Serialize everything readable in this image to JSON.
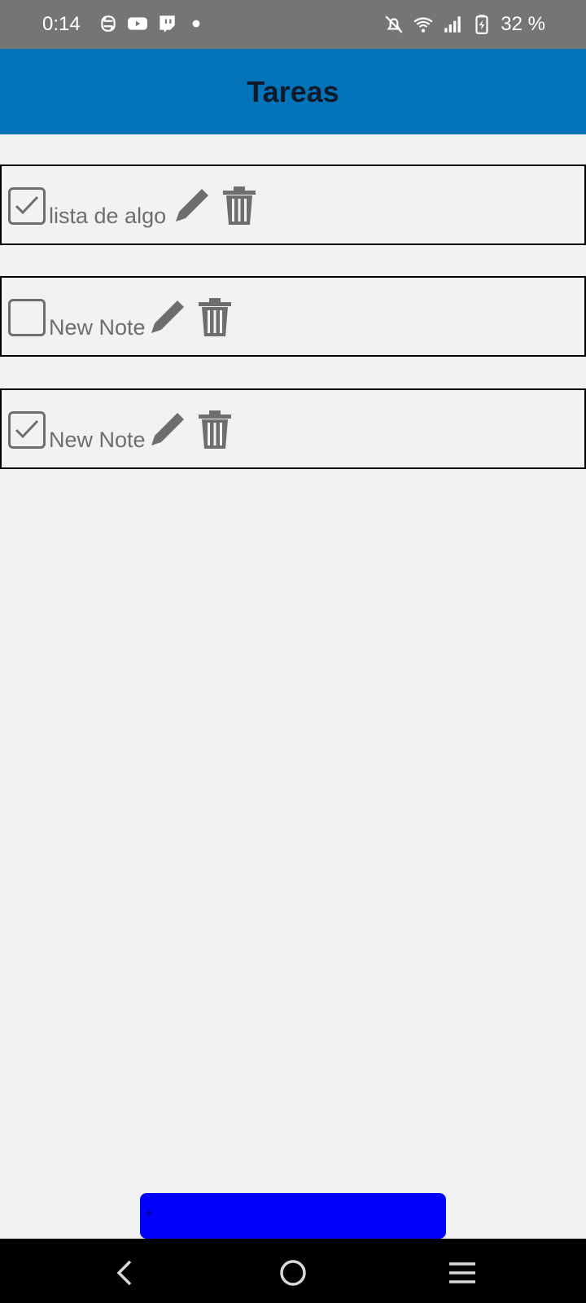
{
  "status_bar": {
    "time": "0:14",
    "battery_text": "32 %",
    "left_icons": [
      "sync-icon",
      "youtube-icon",
      "twitch-icon",
      "dot-icon"
    ],
    "right_icons": [
      "mute-bell-icon",
      "wifi-icon",
      "signal-icon",
      "battery-charging-icon"
    ]
  },
  "app_bar": {
    "title": "Tareas"
  },
  "tasks": [
    {
      "label": "lista de algo",
      "checked": true
    },
    {
      "label": "New Note",
      "checked": false
    },
    {
      "label": "New Note",
      "checked": true
    }
  ],
  "add_button": {
    "icon": "plus-icon",
    "color": "#0000ff"
  },
  "colors": {
    "app_bar": "#0373ba",
    "background": "#f2f2f2",
    "icon_gray": "#6e6e6e"
  }
}
